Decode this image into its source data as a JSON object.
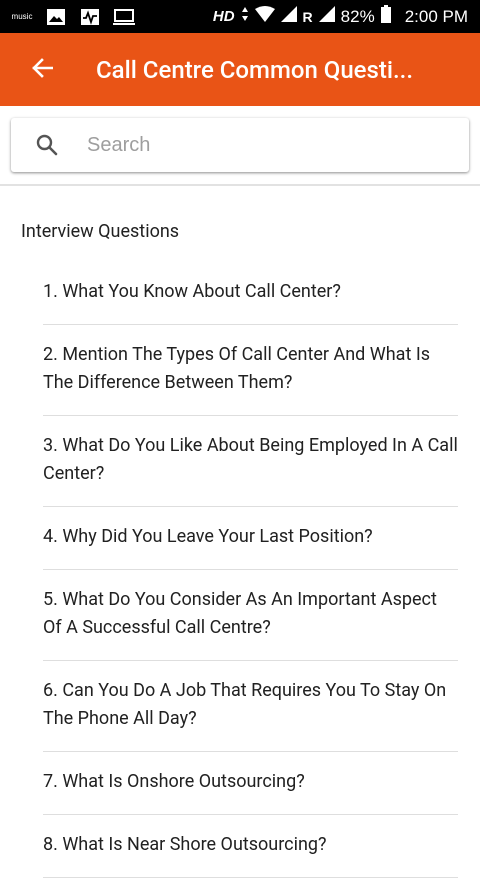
{
  "status_bar": {
    "music_label": "music",
    "hd": "HD",
    "r": "R",
    "battery": "82%",
    "time": "2:00 PM"
  },
  "app_bar": {
    "title": "Call Centre Common Questi..."
  },
  "search": {
    "placeholder": "Search",
    "value": ""
  },
  "section_title": "Interview Questions",
  "questions": [
    "1. What You Know About Call Center?",
    "2. Mention The Types Of Call Center And What Is The Difference Between Them?",
    "3. What Do You Like About Being Employed In A Call Center?",
    "4. Why Did You Leave Your Last Position?",
    "5. What Do You Consider As An Important Aspect Of A Successful Call Centre?",
    "6. Can You Do A Job That Requires You To Stay On The Phone All Day?",
    "7. What Is Onshore Outsourcing?",
    "8. What Is Near Shore Outsourcing?"
  ],
  "colors": {
    "accent": "#e95416",
    "status_bar": "#000000",
    "text": "#212121",
    "divider": "#dedede"
  },
  "icons": {
    "back": "arrow-left-icon",
    "search": "search-icon",
    "status": [
      "music-icon",
      "image-icon",
      "activity-icon",
      "monitor-icon",
      "data-arrows-icon",
      "wifi-icon",
      "signal-icon",
      "battery-icon"
    ]
  }
}
